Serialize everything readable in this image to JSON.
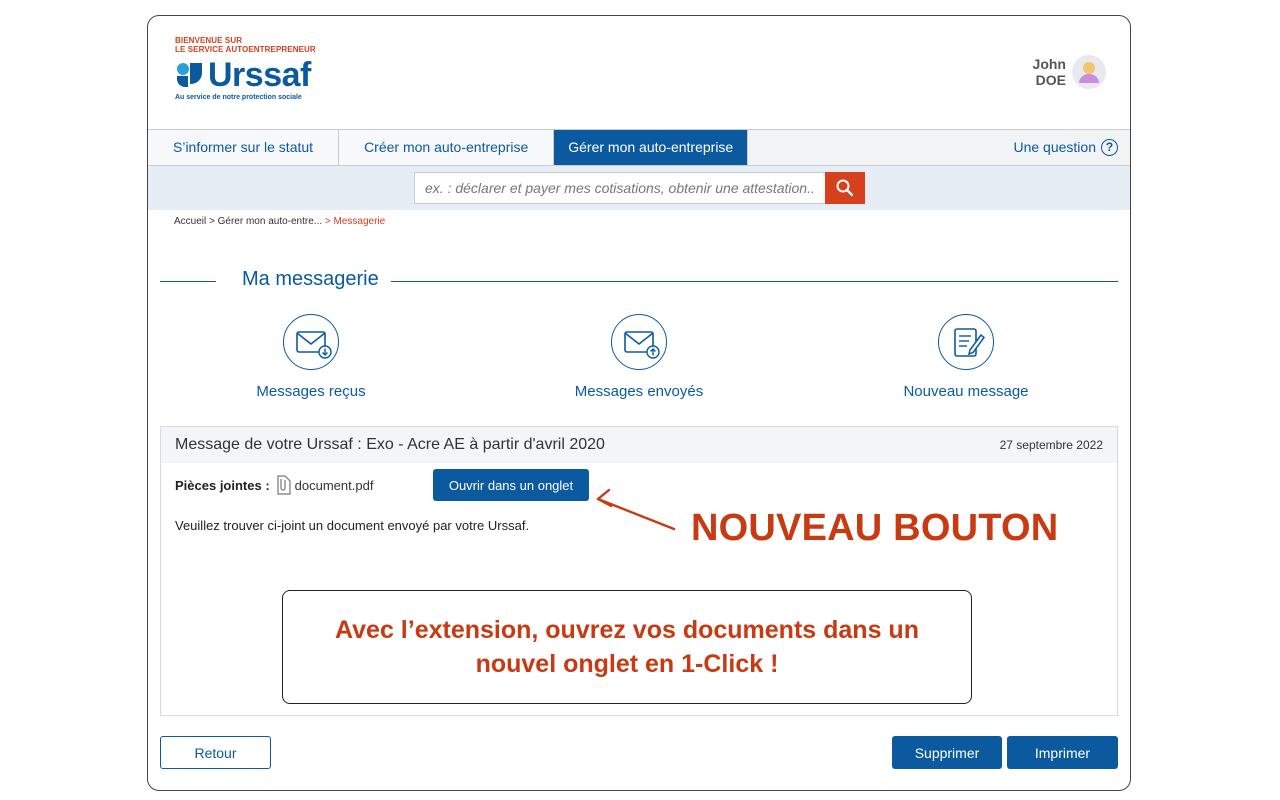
{
  "colors": {
    "accent": "#0b5aa0",
    "brand_red": "#d6401c",
    "callout": "#c83a12"
  },
  "brand": {
    "welcome_line1": "BIENVENUE SUR",
    "welcome_line2": "LE SERVICE AUTOENTREPRENEUR",
    "name": "Urssaf",
    "tagline": "Au service de notre protection sociale",
    "icon": "urssaf-logo-icon"
  },
  "user": {
    "first_name": "John",
    "last_name": "DOE",
    "icon": "user-avatar-icon"
  },
  "nav": {
    "items": [
      {
        "label": "S’informer sur le statut",
        "active": false
      },
      {
        "label": "Créer mon auto-entreprise",
        "active": false
      },
      {
        "label": "Gérer mon auto-entreprise",
        "active": true
      }
    ],
    "question_label": "Une question",
    "question_icon": "question-circle-icon"
  },
  "search": {
    "placeholder": "ex. : déclarer et payer mes cotisations, obtenir une attestation...",
    "icon": "search-icon"
  },
  "breadcrumb": {
    "items": [
      "Accueil",
      "Gérer mon auto-entre..."
    ],
    "separator": ">",
    "current": "> Messagerie",
    "path": "Accueil > Gérer mon auto-entre..."
  },
  "messaging": {
    "title": "Ma messagerie",
    "actions": [
      {
        "label": "Messages reçus",
        "icon": "envelope-download-icon"
      },
      {
        "label": "Messages envoyés",
        "icon": "envelope-upload-icon"
      },
      {
        "label": "Nouveau message",
        "icon": "compose-message-icon"
      }
    ]
  },
  "message": {
    "subject": "Message de votre Urssaf : Exo - Acre AE à partir d'avril 2020",
    "date": "27 septembre 2022",
    "attachments_label": "Pièces jointes :",
    "attachment_file": "document.pdf",
    "attachment_icon": "paperclip-file-icon",
    "open_tab_button": "Ouvrir dans un onglet",
    "body": "Veuillez trouver ci-joint un document envoyé par votre Urssaf."
  },
  "callout": {
    "label": "NOUVEAU BOUTON",
    "promo_line1": "Avec l’extension, ouvrez vos documents dans un",
    "promo_line2": "nouvel onglet en 1-Click !"
  },
  "footer": {
    "back": "Retour",
    "delete": "Supprimer",
    "print": "Imprimer"
  }
}
